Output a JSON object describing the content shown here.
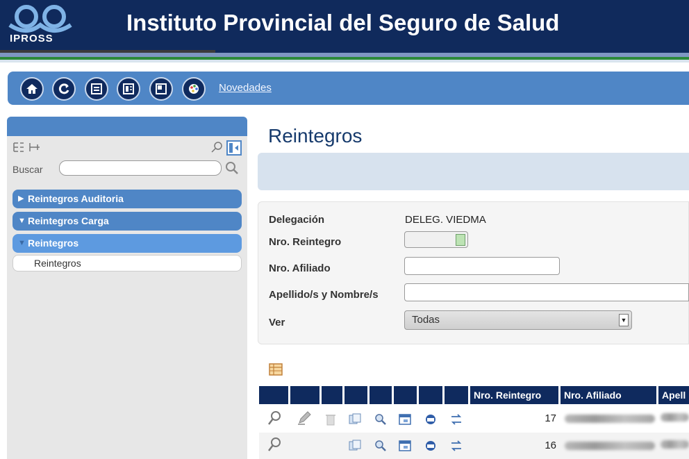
{
  "header": {
    "logo_text": "IPROSS",
    "title": "Instituto Provincial del Seguro de Salud",
    "colors": {
      "header_bg": "#102a5c",
      "accent": "#4f86c6",
      "green_stripe": "#2c8a3a"
    }
  },
  "toolbar": {
    "buttons": [
      {
        "name": "home-button",
        "icon": "home-icon"
      },
      {
        "name": "refresh-button",
        "icon": "refresh-icon"
      },
      {
        "name": "list-button",
        "icon": "list-icon"
      },
      {
        "name": "document-button",
        "icon": "document-icon"
      },
      {
        "name": "window-button",
        "icon": "window-icon"
      },
      {
        "name": "palette-button",
        "icon": "palette-icon"
      }
    ],
    "novedades_label": "Novedades"
  },
  "sidebar": {
    "search_label": "Buscar",
    "search_value": "",
    "items": [
      {
        "label": "Reintegros Auditoria",
        "expanded": false
      },
      {
        "label": "Reintegros Carga",
        "expanded": true
      },
      {
        "label": "Reintegros",
        "expanded": true,
        "active": true
      }
    ],
    "sub_items": [
      "Reintegros"
    ]
  },
  "main": {
    "title": "Reintegros",
    "form": {
      "delegacion_label": "Delegación",
      "delegacion_value": "DELEG. VIEDMA",
      "nro_reintegro_label": "Nro. Reintegro",
      "nro_afiliado_label": "Nro. Afiliado",
      "apellido_label": "Apellido/s y Nombre/s",
      "ver_label": "Ver",
      "ver_selected": "Todas"
    },
    "table": {
      "columns": [
        "Nro. Reintegro",
        "Nro. Afiliado",
        "Apell"
      ],
      "rows": [
        {
          "nro_reintegro": "17"
        },
        {
          "nro_reintegro": "16"
        }
      ]
    }
  }
}
